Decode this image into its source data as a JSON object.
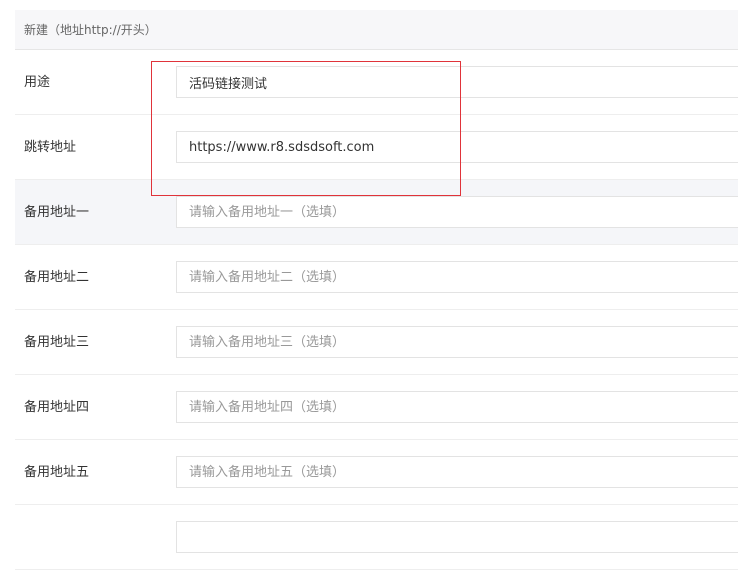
{
  "header": {
    "title": "新建（地址http://开头）"
  },
  "fields": [
    {
      "label": "用途",
      "value": "活码链接测试",
      "placeholder": ""
    },
    {
      "label": "跳转地址",
      "value": "https://www.r8.sdsdsoft.com",
      "placeholder": ""
    },
    {
      "label": "备用地址一",
      "value": "",
      "placeholder": "请输入备用地址一（选填）"
    },
    {
      "label": "备用地址二",
      "value": "",
      "placeholder": "请输入备用地址二（选填）"
    },
    {
      "label": "备用地址三",
      "value": "",
      "placeholder": "请输入备用地址三（选填）"
    },
    {
      "label": "备用地址四",
      "value": "",
      "placeholder": "请输入备用地址四（选填）"
    },
    {
      "label": "备用地址五",
      "value": "",
      "placeholder": "请输入备用地址五（选填）"
    }
  ],
  "colors": {
    "highlight_border": "#e0333a",
    "header_bg": "#f7f7f9",
    "shaded_row_bg": "#f5f6f9"
  }
}
